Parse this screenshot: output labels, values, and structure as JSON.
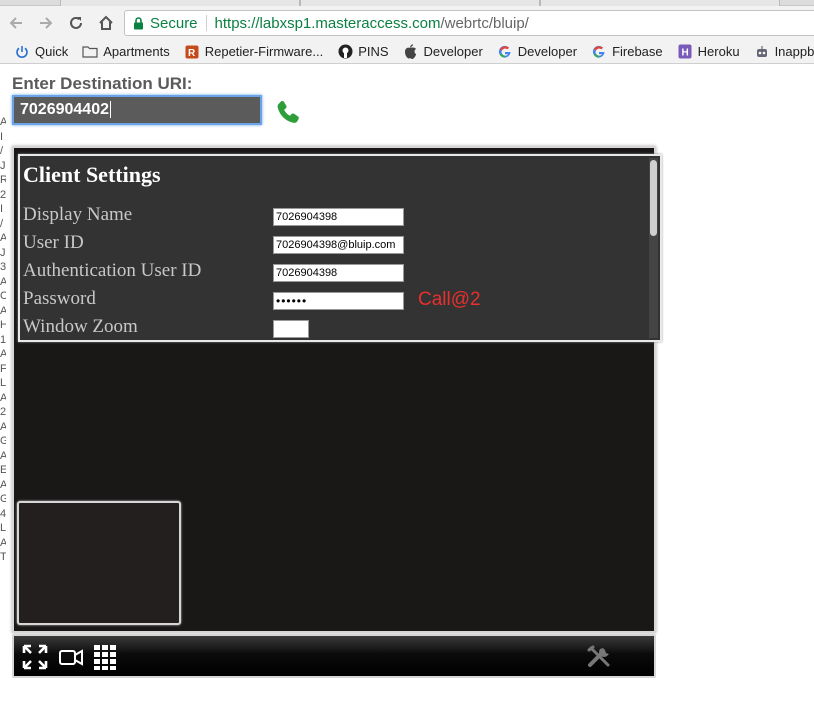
{
  "browser": {
    "url_host": "https://labxsp1.masteraccess.com",
    "url_path": "/webrtc/bluip/",
    "secure_label": "Secure",
    "bookmarks": [
      {
        "label": "Quick",
        "icon": "power-icon"
      },
      {
        "label": "Apartments",
        "icon": "folder-icon"
      },
      {
        "label": "Repetier-Firmware...",
        "icon": "repetier-icon"
      },
      {
        "label": "PINS",
        "icon": "github-icon"
      },
      {
        "label": "Developer",
        "icon": "apple-icon"
      },
      {
        "label": "Developer",
        "icon": "google-icon"
      },
      {
        "label": "Firebase",
        "icon": "google-icon"
      },
      {
        "label": "Heroku",
        "icon": "heroku-icon"
      },
      {
        "label": "Inappbrow",
        "icon": "robot-icon"
      }
    ]
  },
  "page": {
    "destination_label": "Enter Destination URI:",
    "destination_value": "7026904402",
    "left_strip_text": "A\nI\n/\nJ\nR\n2\nI\n/\nA\nJ\n3\nA\nC\nA\nH\n1\nA\nF\nL\nA\n2\nA\nG\nA\nE\nA\nG\n4\nL\nA\nT"
  },
  "settings": {
    "title": "Client Settings",
    "display_name_label": "Display Name",
    "display_name_value": "7026904398",
    "user_id_label": "User ID",
    "user_id_value": "7026904398@bluip.com",
    "auth_user_id_label": "Authentication User ID",
    "auth_user_id_value": "7026904398",
    "password_label": "Password",
    "password_value": "••••••",
    "password_hint": "Call@2",
    "window_zoom_label": "Window Zoom",
    "window_zoom_value": ""
  },
  "colors": {
    "call_green": "#2f9d3a",
    "hint_red": "#e8302c",
    "secure_green": "#0b8043",
    "focus_blue": "#6aa4e6"
  }
}
